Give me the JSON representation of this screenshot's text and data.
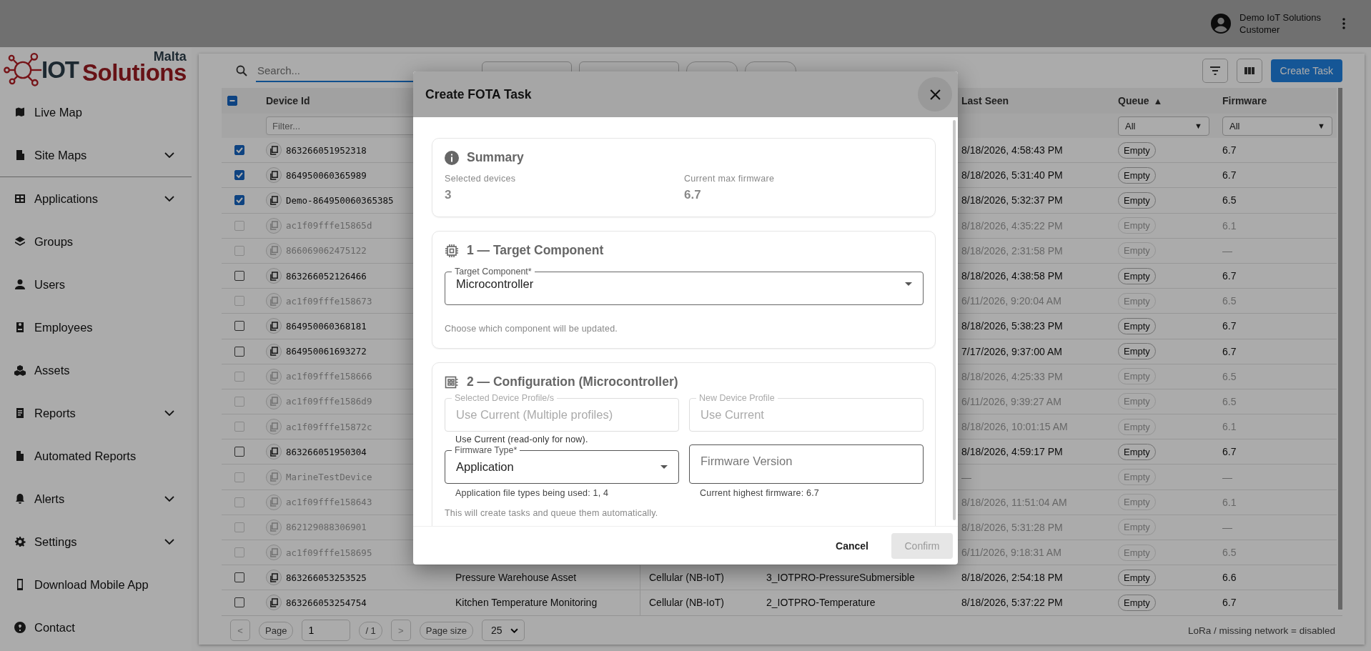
{
  "header": {
    "user_name": "Demo IoT Solutions",
    "user_role": "Customer"
  },
  "logo": {
    "word_1": "IOT",
    "word_2": "Solutions",
    "region": "Malta"
  },
  "sidebar": {
    "items": [
      {
        "label": "Live Map",
        "expandable": false,
        "divider_after": false
      },
      {
        "label": "Site Maps",
        "expandable": true,
        "divider_after": true
      },
      {
        "label": "Applications",
        "expandable": true,
        "divider_after": false
      },
      {
        "label": "Groups",
        "expandable": false,
        "divider_after": false
      },
      {
        "label": "Users",
        "expandable": false,
        "divider_after": false
      },
      {
        "label": "Employees",
        "expandable": false,
        "divider_after": false
      },
      {
        "label": "Assets",
        "expandable": false,
        "divider_after": false
      },
      {
        "label": "Reports",
        "expandable": true,
        "divider_after": false
      },
      {
        "label": "Automated Reports",
        "expandable": false,
        "divider_after": false
      },
      {
        "label": "Alerts",
        "expandable": true,
        "divider_after": false
      },
      {
        "label": "Settings",
        "expandable": true,
        "divider_after": false
      },
      {
        "label": "Download Mobile App",
        "expandable": false,
        "divider_after": false
      },
      {
        "label": "Contact",
        "expandable": false,
        "divider_after": false
      }
    ]
  },
  "toolbar": {
    "search": {
      "placeholder": "Search..."
    },
    "chips": [
      {
        "kind": "button"
      },
      {
        "kind": "button"
      },
      {
        "kind": "count"
      },
      {
        "kind": "count"
      }
    ],
    "create_button": "Create Task"
  },
  "table": {
    "select_all_partial": true,
    "columns": {
      "device_id": {
        "label": "Device Id",
        "filter_placeholder": "Filter..."
      },
      "last_seen": {
        "label": "Last Seen"
      },
      "queue": {
        "label": "Queue",
        "sort_mark": "▲",
        "filter": "All",
        "filter_caret": "▼"
      },
      "firmware": {
        "label": "Firmware",
        "filter": "All",
        "filter_caret": "▼"
      }
    },
    "rows": [
      {
        "device_id": "863266051952318",
        "checked": true,
        "disabled": false,
        "last_seen": "8/18/2026, 4:58:43 PM",
        "queue": "Empty",
        "firmware": "6.7"
      },
      {
        "device_id": "864950060365989",
        "checked": true,
        "disabled": false,
        "last_seen": "8/18/2026, 5:31:40 PM",
        "queue": "Empty",
        "firmware": "6.7"
      },
      {
        "device_id": "Demo-864950060365385",
        "checked": true,
        "disabled": false,
        "last_seen": "8/18/2026, 5:32:37 PM",
        "queue": "Empty",
        "firmware": "6.5"
      },
      {
        "device_id": "ac1f09fffe15865d",
        "checked": false,
        "disabled": true,
        "last_seen": "8/18/2026, 4:35:22 PM",
        "queue": "Empty",
        "firmware": "6.1"
      },
      {
        "device_id": "866069062475122",
        "checked": false,
        "disabled": true,
        "last_seen": "8/18/2026, 2:31:58 PM",
        "queue": "Empty",
        "firmware": "—"
      },
      {
        "device_id": "863266052126466",
        "checked": false,
        "disabled": false,
        "last_seen": "8/18/2026, 4:38:58 PM",
        "queue": "Empty",
        "firmware": "6.7"
      },
      {
        "device_id": "ac1f09fffe158673",
        "checked": false,
        "disabled": true,
        "last_seen": "6/11/2026, 9:20:04 AM",
        "queue": "Empty",
        "firmware": "6.5"
      },
      {
        "device_id": "864950060368181",
        "checked": false,
        "disabled": false,
        "last_seen": "8/18/2026, 5:38:23 PM",
        "queue": "Empty",
        "firmware": "6.7"
      },
      {
        "device_id": "864950061693272",
        "checked": false,
        "disabled": false,
        "last_seen": "7/17/2026, 9:37:00 AM",
        "queue": "Empty",
        "firmware": "6.7"
      },
      {
        "device_id": "ac1f09fffe158666",
        "checked": false,
        "disabled": true,
        "last_seen": "8/18/2026, 4:25:33 PM",
        "queue": "Empty",
        "firmware": "6.5"
      },
      {
        "device_id": "ac1f09fffe1586d9",
        "checked": false,
        "disabled": true,
        "last_seen": "6/11/2026, 9:39:27 AM",
        "queue": "Empty",
        "firmware": "6.5"
      },
      {
        "device_id": "ac1f09fffe15872c",
        "checked": false,
        "disabled": true,
        "last_seen": "8/18/2026, 10:01:15 AM",
        "queue": "Empty",
        "firmware": "6.1"
      },
      {
        "device_id": "863266051950304",
        "checked": false,
        "disabled": false,
        "last_seen": "8/18/2026, 4:59:17 PM",
        "queue": "Empty",
        "firmware": "6.7"
      },
      {
        "device_id": "MarineTestDevice",
        "checked": false,
        "disabled": true,
        "last_seen": "—",
        "queue": "Empty",
        "firmware": "—"
      },
      {
        "device_id": "ac1f09fffe158643",
        "checked": false,
        "disabled": true,
        "last_seen": "8/18/2026, 11:51:04 AM",
        "queue": "Empty",
        "firmware": "6.1"
      },
      {
        "device_id": "862129088306901",
        "checked": false,
        "disabled": true,
        "last_seen": "8/18/2026, 5:31:28 PM",
        "queue": "Empty",
        "firmware": "—"
      },
      {
        "device_id": "ac1f09fffe158695",
        "checked": false,
        "disabled": true,
        "last_seen": "6/11/2026, 9:18:31 AM",
        "queue": "Empty",
        "firmware": "6.5"
      },
      {
        "device_id": "863266053253525",
        "checked": false,
        "disabled": false,
        "name": "Pressure Warehouse Asset",
        "network": "Cellular (NB-IoT)",
        "profile": "3_IOTPRO-PressureSubmersible",
        "last_seen": "8/18/2026, 2:54:18 PM",
        "queue": "Empty",
        "firmware": "6.6"
      },
      {
        "device_id": "863266053254754",
        "checked": false,
        "disabled": false,
        "name": "Kitchen Temperature Monitoring",
        "network": "Cellular (NB-IoT)",
        "profile": "2_IOTPRO-Temperature",
        "last_seen": "8/18/2026, 5:37:22 PM",
        "queue": "Empty",
        "firmware": "6.7"
      }
    ]
  },
  "pagination": {
    "prev": "<",
    "page_label": "Page",
    "page": "1",
    "total": "/ 1",
    "next": ">",
    "size_label": "Page size",
    "size": "25",
    "note": "LoRa / missing network = disabled"
  },
  "dialog": {
    "title": "Create FOTA Task",
    "summary": {
      "title": "Summary",
      "items": [
        {
          "label": "Selected devices",
          "value": "3"
        },
        {
          "label": "Current max firmware",
          "value": "6.7"
        }
      ]
    },
    "target": {
      "title": "1 — Target Component",
      "field": {
        "label": "Target Component*",
        "value": "Microcontroller"
      },
      "helper": "Choose which component will be updated."
    },
    "config": {
      "title": "2 — Configuration (Microcontroller)",
      "profile_fields": [
        {
          "label": "Selected Device Profile/s",
          "value": "Use Current (Multiple profiles)",
          "disabled": true
        },
        {
          "label": "New Device Profile",
          "value": "Use Current",
          "disabled": true
        }
      ],
      "profile_helper": "Use Current (read-only for now).",
      "firmware_type": {
        "label": "Firmware Type*",
        "value": "Application",
        "helper": "Application file types being used: 1, 4"
      },
      "firmware_version": {
        "placeholder": "Firmware Version",
        "helper": "Current highest firmware: 6.7"
      },
      "note": "This will create tasks and queue them automatically."
    },
    "cancel": "Cancel",
    "confirm": {
      "label": "Confirm",
      "disabled": true
    }
  }
}
